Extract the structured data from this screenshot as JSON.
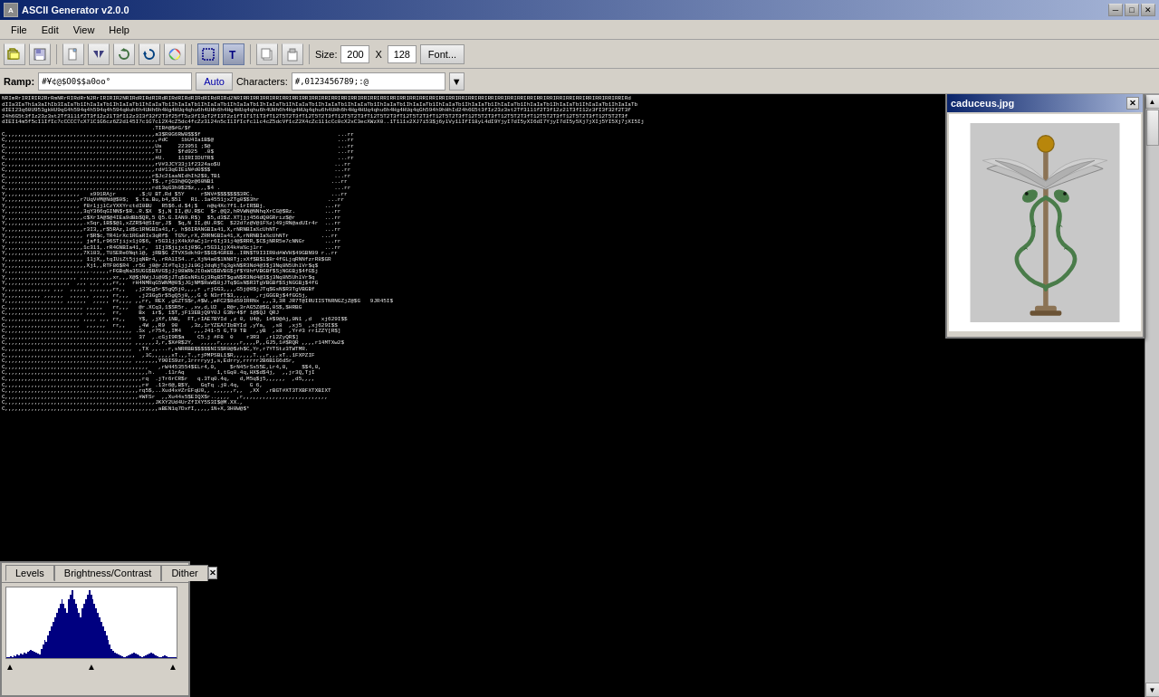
{
  "titlebar": {
    "title": "ASCII Generator v2.0.0",
    "min_btn": "─",
    "max_btn": "□",
    "close_btn": "✕"
  },
  "menu": {
    "items": [
      "File",
      "Edit",
      "View",
      "Help"
    ]
  },
  "toolbar": {
    "size_label": "Size:",
    "size_value": "200",
    "x_label": "X",
    "height_value": "128",
    "font_label": "Font...",
    "icons": [
      "open-icon",
      "save-icon",
      "new-icon",
      "flip-h-icon",
      "flip-v-icon",
      "refresh-icon",
      "color-icon",
      "rect-select-icon",
      "text-icon",
      "undo-icon",
      "redo-icon"
    ]
  },
  "ramp": {
    "label": "Ramp:",
    "ramp_value": "#¥¢@$O0$$a0oo°",
    "auto_label": "Auto",
    "chars_label": "Characters:",
    "chars_value": "#,0123456789;:@",
    "dropdown_arrow": "▼"
  },
  "preview": {
    "title": "caduceus.jpg",
    "close_btn": "✕"
  },
  "levels": {
    "close_btn": "✕",
    "tabs": [
      "Levels",
      "Brightness/Contrast",
      "Dither"
    ],
    "active_tab": 0
  },
  "ascii_art": "NRImRrIRIRIR2RrRmNRrRIRdRrN2RrIRIRIR2NRIRdRIRdRIRdRIRdRIRdRIRdRIRdRIRd2NRIRRIRRIRRIRRIRRIRRIRRIRRIRRIRRIRR IRRIRRIRRIRRIRRIRRIRd\ndIIa3IaTh1a3aIhIb3IaIaTb1IhIaIaTb1IhIaIaTb1IhIaIaTb1IhIaIaTb1IhIaIaTb1IhIaIaTb1IhIaIaTb1IhIaIaTb1IhIaIaTb1IhIaIaTb1IhIaIaTb1IhIaIaTb\ndIEI23q60U953gkHU9qG4h594q4h594q4h594qHuh6h4UHh6h4Hg4HUq4qhu6h4UHh6h4Hg4HUq4qhu6h4UHh6h4Hg4HUq4qhu6h4UHh6h4Hg4HUq4qhu6h4Hg4HUq4qGh5\n24h6G5t3fIz23z31f2T3fI11f2T3f12z2lT3fI12z3I3f32f2T3f25fT5z3fI3zT2fI3T2z1fT1T1T1T3fT12T5T2T3fT12T5T2T3fT12T5T2T3fT12T5T2T3fT12T5T2T3f\ndIEI14m5f5cIlIfIc7cCCCC7cX7lC1G6cz6Z2dl45I7c1G7cl2X4cZ5dc4fcZz3l24n5cIlIfIcfcllc4cZ5dcVf1cZ2X4cZc1l1cCc0cX2xC3ecXWzX0..1T1l1x2XJ7i53\n;,,,,,,,,,,,,,,,,,,,,,,,,,,,,,,,,,,,,,,,,,,,,,,,,,,,,,,,,,,,,,,,,,,,,,,,,,,,,,,,,,,,,,,,,,,,,,,,,,,,,,,,,,,,,,,,,,,,,,,,,,,,,,,,,,,,,,,,,,,,,\n`,,,,,,,,,,,,,,,,,,,,,,,,,,,,,,,,,,,,,,,,,,,,,,,,,,,,,,,,,,,,,,,,,,,,,,,,,,,,,,,,,,,,,,,,,,,,,,,,,,,,,,,,,,,,,,,,,,,,,,,,,,,,,,,,,,,,,,,,,,,,\nY,,,,,,,,,,,,,,,,,,,,,,,,,,,,,,,,,,,,,,,,,,,,,,,,,,,,,,,,,,,,,,,,,,,,,,,,,,,,,,,,,,,,,,,,,,,,,,,,,,,,,,,,,,,,,,,,,,,,,,,,,,,,,,,,,,,,,,,,,,,\nY,,,,,,,,,,,,,,,,,,,,,,,,,,,,,,,,,,,,,,,,,,,,,,,,,,,,,,,,,,,,,,,,,,,,,,,,,,,,,,,,,,,,,,,,,,,,,,,,,,,,,,,,,,,,,,,,,,,,,,,,,,,,,,,,,,,,,,,,,,,\n`,,,,,,,,,,,,,,,,,,,,,,,,,,,,,,,,,,,,,,,,,,,,,,,,,,,,,,,,,,,,,,,,,,,,,,,,,,,,,,,,,,,,,,,,,,,,,,,,,,,,,,,,,,,,,,,,,,,,,,,,,,,,,,,,,,,,,,,,,,,"
}
